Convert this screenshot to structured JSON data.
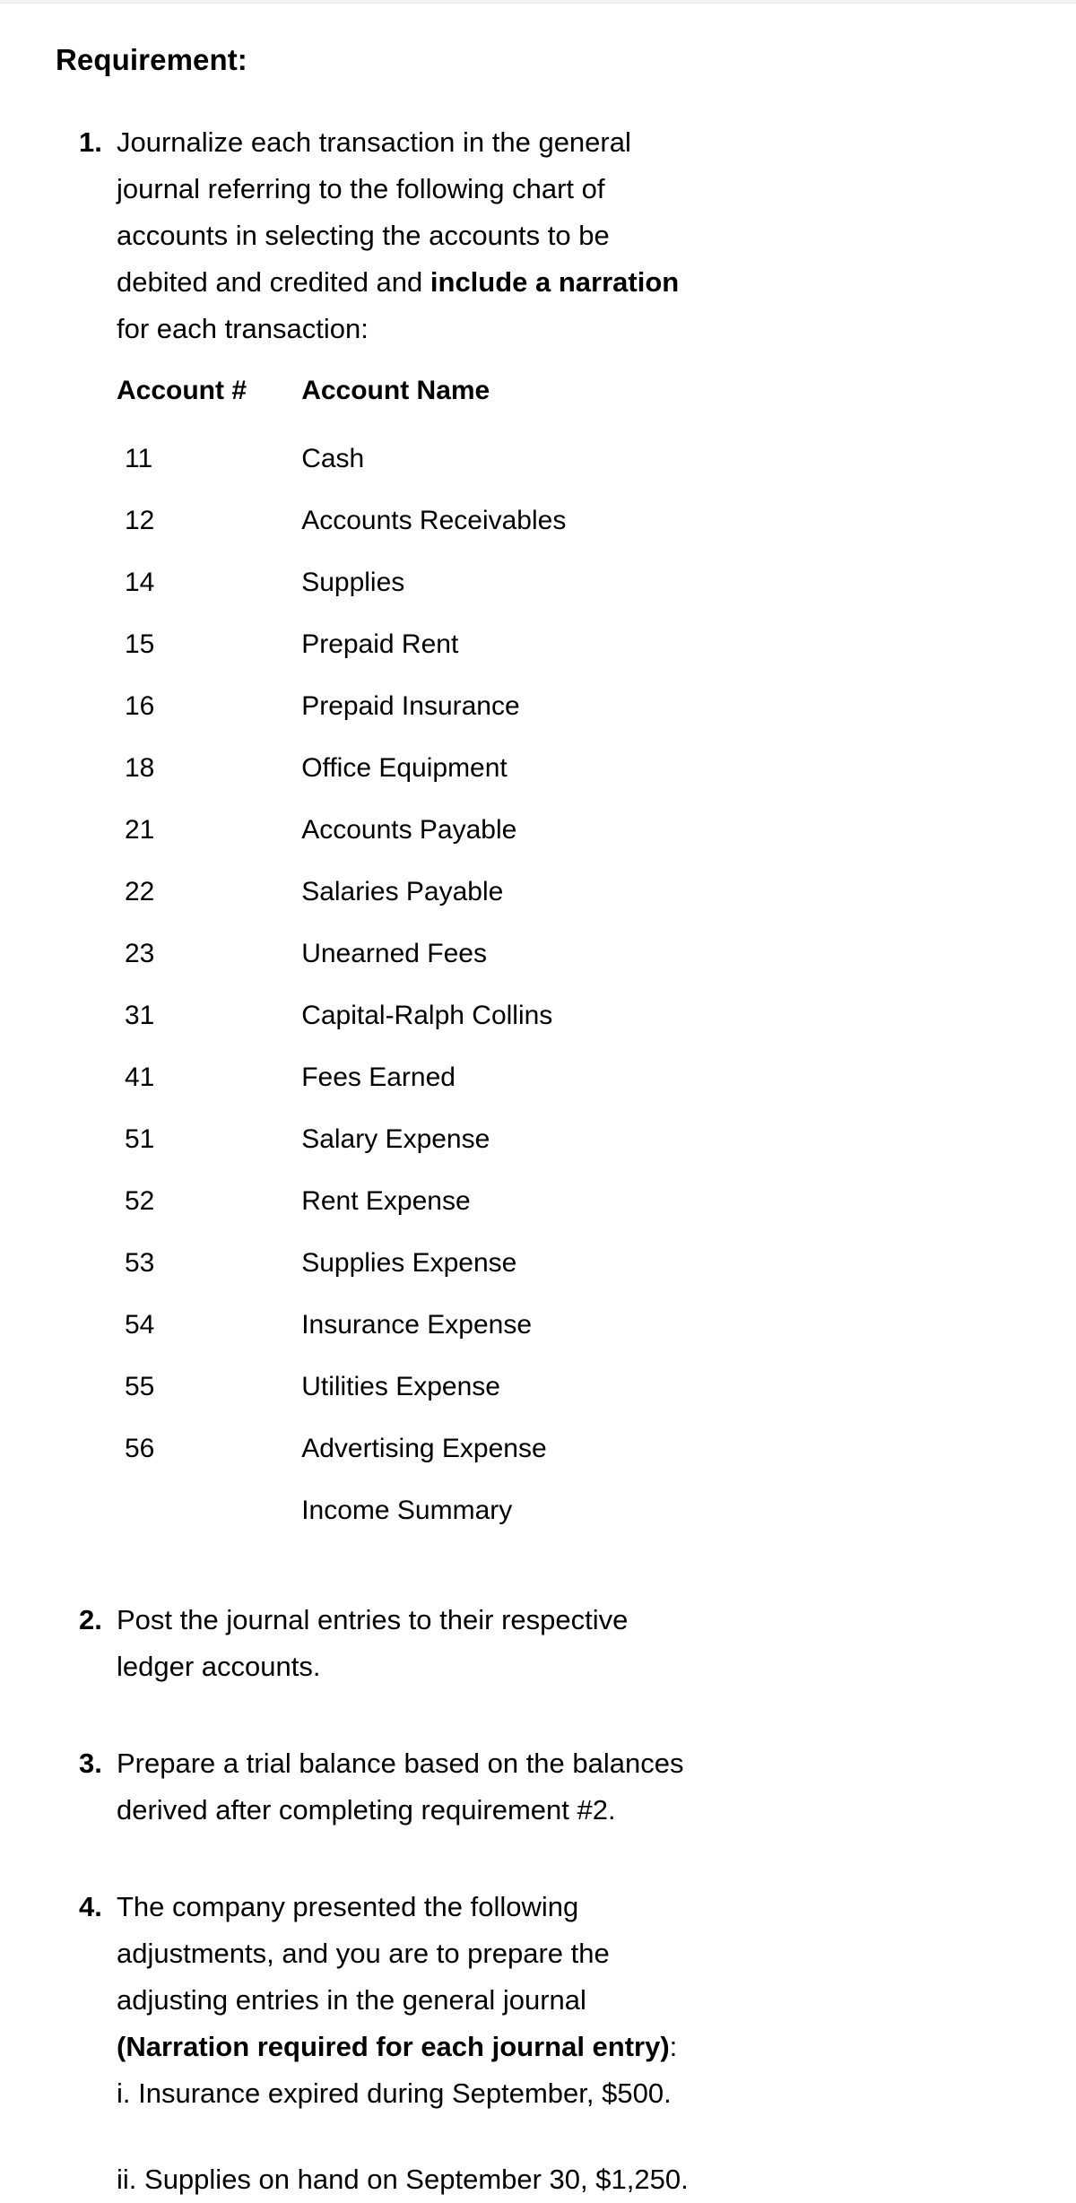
{
  "document": {
    "title": "Requirement:"
  },
  "requirements": [
    {
      "number": "1.",
      "text_part1": "Journalize each transaction in the general journal referring to the following chart of accounts in selecting the accounts to be debited and credited and ",
      "bold_part": "include a narration",
      "text_part2": " for each transaction:"
    },
    {
      "number": "2.",
      "text": "Post the journal entries to their respective ledger accounts."
    },
    {
      "number": "3.",
      "text": "Prepare a trial balance based on the balances derived after completing requirement #2."
    },
    {
      "number": "4.",
      "text_part1": "The company presented the following adjustments, and you are to prepare the adjusting entries in the general journal ",
      "bold_part": "(Narration required for each journal entry)",
      "text_part2": ":"
    }
  ],
  "chart_of_accounts": {
    "headers": {
      "account_number": "Account #",
      "account_name": "Account Name"
    },
    "rows": [
      {
        "number": "11",
        "name": "Cash"
      },
      {
        "number": "12",
        "name": "Accounts Receivables"
      },
      {
        "number": "14",
        "name": "Supplies"
      },
      {
        "number": "15",
        "name": "Prepaid Rent"
      },
      {
        "number": "16",
        "name": "Prepaid Insurance"
      },
      {
        "number": "18",
        "name": "Office Equipment"
      },
      {
        "number": "21",
        "name": "Accounts Payable"
      },
      {
        "number": "22",
        "name": "Salaries Payable"
      },
      {
        "number": "23",
        "name": "Unearned Fees"
      },
      {
        "number": "31",
        "name": "Capital-Ralph Collins"
      },
      {
        "number": "41",
        "name": "Fees Earned"
      },
      {
        "number": "51",
        "name": "Salary Expense"
      },
      {
        "number": "52",
        "name": "Rent Expense"
      },
      {
        "number": "53",
        "name": "Supplies Expense"
      },
      {
        "number": "54",
        "name": "Insurance Expense"
      },
      {
        "number": "55",
        "name": "Utilities Expense"
      },
      {
        "number": "56",
        "name": "Advertising Expense"
      },
      {
        "number": "",
        "name": "Income Summary"
      }
    ]
  },
  "adjustments": [
    {
      "label": "i.",
      "text": "Insurance expired during September, $500."
    },
    {
      "label": "ii.",
      "text": "Supplies on hand on September 30, $1,250."
    }
  ]
}
